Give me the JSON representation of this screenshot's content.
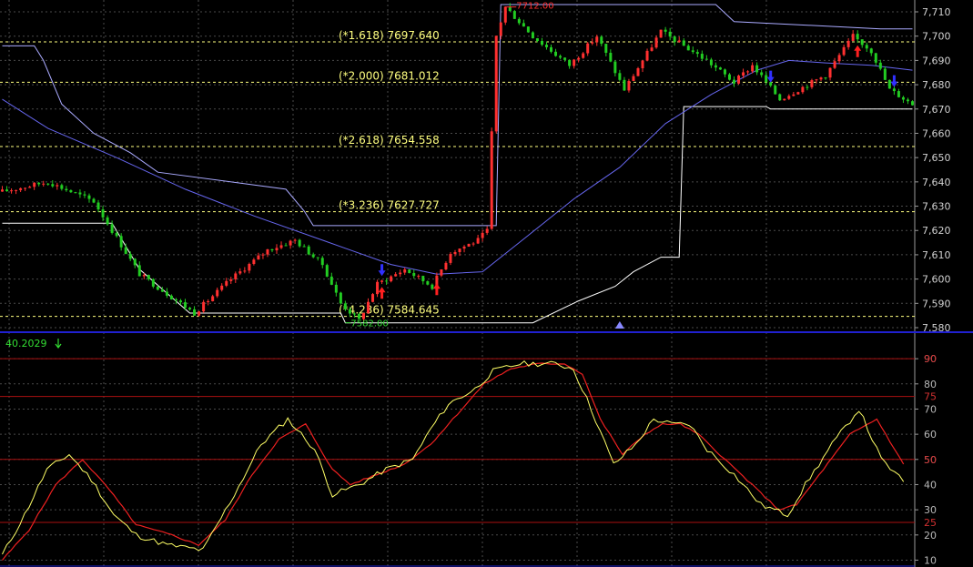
{
  "colors": {
    "background": "#000000",
    "grid": "#4a4a4a",
    "candle_up": "#ff3030",
    "candle_down": "#22cc22",
    "upper_channel": "#aaaaff",
    "lower_channel": "#ffffff",
    "moving_average": "#6666ee",
    "fib_line": "#ffff80",
    "separator": "#2020d0",
    "stoch_k": "#ffff66",
    "stoch_d": "#ee2020",
    "ref_line": "#aa1010",
    "buy_arrow": "#ff2020",
    "sell_arrow": "#3030ff",
    "marker": "#8888ff",
    "high_label": "#ff3030",
    "low_label": "#33dd33"
  },
  "chart_data": [
    {
      "type": "candlestick",
      "ylim": [
        7580,
        7713
      ],
      "y_ticks": [
        "7,580",
        "7,590",
        "7,600",
        "7,610",
        "7,620",
        "7,630",
        "7,640",
        "7,650",
        "7,660",
        "7,670",
        "7,680",
        "7,690",
        "7,700",
        "7,710"
      ],
      "bar_count": 200,
      "price_path": [
        [
          0,
          7636
        ],
        [
          10,
          7640
        ],
        [
          20,
          7632
        ],
        [
          24,
          7620
        ],
        [
          30,
          7602
        ],
        [
          36,
          7594
        ],
        [
          42,
          7586
        ],
        [
          50,
          7600
        ],
        [
          58,
          7612
        ],
        [
          64,
          7616
        ],
        [
          70,
          7606
        ],
        [
          74,
          7590
        ],
        [
          78,
          7583
        ],
        [
          82,
          7598
        ],
        [
          88,
          7604
        ],
        [
          94,
          7597
        ],
        [
          98,
          7611
        ],
        [
          104,
          7616
        ],
        [
          106,
          7620
        ],
        [
          108,
          7700
        ],
        [
          110,
          7712
        ],
        [
          116,
          7700
        ],
        [
          124,
          7688
        ],
        [
          130,
          7700
        ],
        [
          136,
          7678
        ],
        [
          144,
          7702
        ],
        [
          154,
          7690
        ],
        [
          160,
          7681
        ],
        [
          164,
          7688
        ],
        [
          170,
          7674
        ],
        [
          180,
          7684
        ],
        [
          186,
          7700
        ],
        [
          190,
          7694
        ],
        [
          194,
          7678
        ],
        [
          199,
          7672
        ]
      ],
      "upper_channel": [
        [
          0,
          7696
        ],
        [
          7,
          7696
        ],
        [
          9,
          7690
        ],
        [
          13,
          7672
        ],
        [
          20,
          7660
        ],
        [
          28,
          7652
        ],
        [
          34,
          7644
        ],
        [
          62,
          7637
        ],
        [
          66,
          7628
        ],
        [
          68,
          7622
        ],
        [
          108,
          7622
        ],
        [
          109,
          7713
        ],
        [
          156,
          7713
        ],
        [
          160,
          7706
        ],
        [
          192,
          7703
        ],
        [
          199,
          7703
        ]
      ],
      "lower_channel": [
        [
          0,
          7623
        ],
        [
          24,
          7623
        ],
        [
          30,
          7604
        ],
        [
          41,
          7586
        ],
        [
          74,
          7586
        ],
        [
          75,
          7582
        ],
        [
          116,
          7582
        ],
        [
          126,
          7591
        ],
        [
          134,
          7597
        ],
        [
          138,
          7603
        ],
        [
          144,
          7609
        ],
        [
          148,
          7609
        ],
        [
          149,
          7671
        ],
        [
          167,
          7671
        ],
        [
          168,
          7670
        ],
        [
          199,
          7670
        ]
      ],
      "moving_average": [
        [
          0,
          7674
        ],
        [
          10,
          7662
        ],
        [
          25,
          7650
        ],
        [
          40,
          7637
        ],
        [
          55,
          7626
        ],
        [
          70,
          7616
        ],
        [
          85,
          7606
        ],
        [
          95,
          7602
        ],
        [
          105,
          7603
        ],
        [
          115,
          7618
        ],
        [
          125,
          7633
        ],
        [
          135,
          7646
        ],
        [
          145,
          7664
        ],
        [
          155,
          7676
        ],
        [
          165,
          7686
        ],
        [
          172,
          7690
        ],
        [
          180,
          7689
        ],
        [
          190,
          7688
        ],
        [
          199,
          7686
        ]
      ],
      "fibonacci": [
        {
          "label": "(*1.618) 7697.640",
          "value": 7697.64
        },
        {
          "label": "(*2.000) 7681.012",
          "value": 7681.012
        },
        {
          "label": "(*2.618) 7654.558",
          "value": 7654.558
        },
        {
          "label": "(*3.236) 7627.727",
          "value": 7627.727
        },
        {
          "label": "(*4.236) 7584.645",
          "value": 7584.645
        }
      ],
      "high_label": {
        "text": "7712.00",
        "bar": 110,
        "value": 7712
      },
      "low_label": {
        "text": "7582.00",
        "bar": 75,
        "value": 7582
      },
      "signals": [
        {
          "type": "buy",
          "bar": 83
        },
        {
          "type": "sell",
          "bar": 83
        },
        {
          "type": "buy",
          "bar": 95
        },
        {
          "type": "sell",
          "bar": 168
        },
        {
          "type": "buy",
          "bar": 187
        },
        {
          "type": "sell",
          "bar": 195
        }
      ],
      "marker_bar": 135
    },
    {
      "type": "line",
      "ylim": [
        8,
        98
      ],
      "y_ticks": [
        "10",
        "20",
        "30",
        "40",
        "50",
        "60",
        "70",
        "80",
        "90"
      ],
      "ref_lines": [
        25,
        50,
        75,
        90
      ],
      "ref_labels": [
        "25",
        "50",
        "75",
        "90"
      ],
      "current_value": "40.2029",
      "series": [
        {
          "values": [
            [
              0,
              12
            ],
            [
              5,
              28
            ],
            [
              10,
              46
            ],
            [
              15,
              52
            ],
            [
              20,
              42
            ],
            [
              25,
              28
            ],
            [
              30,
              20
            ],
            [
              37,
              16
            ],
            [
              45,
              14
            ],
            [
              52,
              36
            ],
            [
              58,
              56
            ],
            [
              64,
              66
            ],
            [
              70,
              54
            ],
            [
              74,
              36
            ],
            [
              80,
              40
            ],
            [
              86,
              46
            ],
            [
              92,
              50
            ],
            [
              96,
              62
            ],
            [
              100,
              72
            ],
            [
              106,
              78
            ],
            [
              110,
              85
            ],
            [
              116,
              88
            ],
            [
              124,
              88
            ],
            [
              128,
              86
            ],
            [
              132,
              70
            ],
            [
              137,
              48
            ],
            [
              142,
              56
            ],
            [
              146,
              66
            ],
            [
              150,
              64
            ],
            [
              154,
              64
            ],
            [
              158,
              54
            ],
            [
              164,
              44
            ],
            [
              170,
              32
            ],
            [
              176,
              28
            ],
            [
              180,
              40
            ],
            [
              186,
              56
            ],
            [
              192,
              70
            ],
            [
              197,
              50
            ],
            [
              202,
              41
            ]
          ]
        },
        {
          "values": [
            [
              0,
              10
            ],
            [
              6,
              22
            ],
            [
              12,
              40
            ],
            [
              18,
              50
            ],
            [
              24,
              38
            ],
            [
              30,
              24
            ],
            [
              38,
              20
            ],
            [
              44,
              16
            ],
            [
              50,
              26
            ],
            [
              56,
              44
            ],
            [
              62,
              58
            ],
            [
              68,
              64
            ],
            [
              74,
              46
            ],
            [
              78,
              40
            ],
            [
              84,
              44
            ],
            [
              90,
              48
            ],
            [
              96,
              56
            ],
            [
              102,
              68
            ],
            [
              108,
              80
            ],
            [
              114,
              86
            ],
            [
              120,
              88
            ],
            [
              126,
              88
            ],
            [
              130,
              84
            ],
            [
              134,
              66
            ],
            [
              139,
              52
            ],
            [
              144,
              60
            ],
            [
              148,
              64
            ],
            [
              152,
              64
            ],
            [
              156,
              60
            ],
            [
              162,
              50
            ],
            [
              168,
              40
            ],
            [
              174,
              30
            ],
            [
              178,
              32
            ],
            [
              184,
              46
            ],
            [
              190,
              60
            ],
            [
              196,
              66
            ],
            [
              202,
              48
            ]
          ]
        }
      ]
    }
  ]
}
